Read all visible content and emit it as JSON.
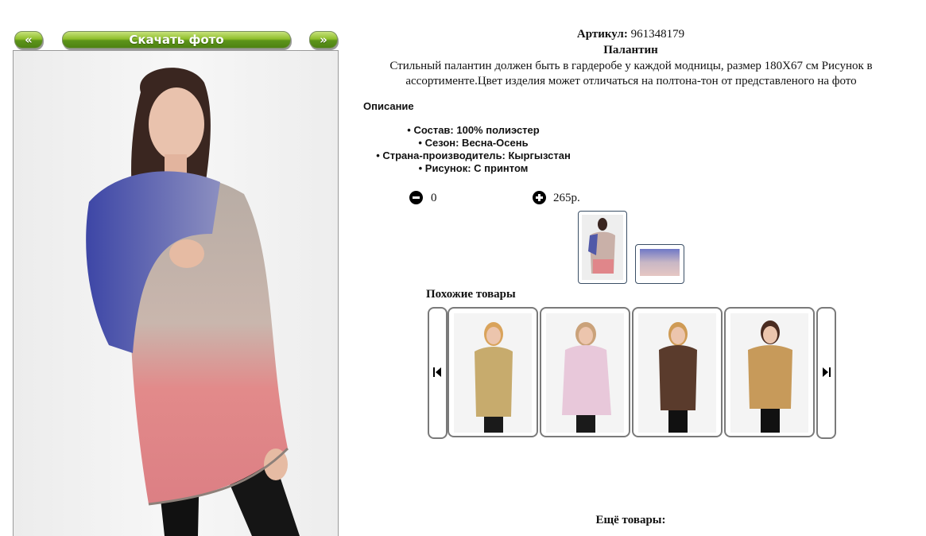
{
  "nav": {
    "prev_label": "«",
    "download_label": "Скачать фото",
    "next_label": "»"
  },
  "product": {
    "sku_label": "Артикул:",
    "sku_value": "961348179",
    "name": "Палантин",
    "description": "Стильный палантин должен быть в гардеробе у каждой модницы, размер 180X67 см Рисунок в ассортименте.Цвет изделия может отличаться на полтона-тон от представленого на фото",
    "description_heading": "Описание",
    "properties": [
      "• Состав: 100% полиэстер",
      "• Сезон: Весна-Осень",
      "• Страна-производитель: Кыргызстан",
      "• Рисунок: С принтом"
    ],
    "quantity": "0",
    "price": "265р."
  },
  "icons": {
    "minus": "minus-circle-icon",
    "plus": "plus-circle-icon",
    "first": "skip-first-icon",
    "last": "skip-last-icon"
  },
  "similar": {
    "heading": "Похожие товары"
  },
  "more": {
    "heading": "Ещё товары:"
  }
}
